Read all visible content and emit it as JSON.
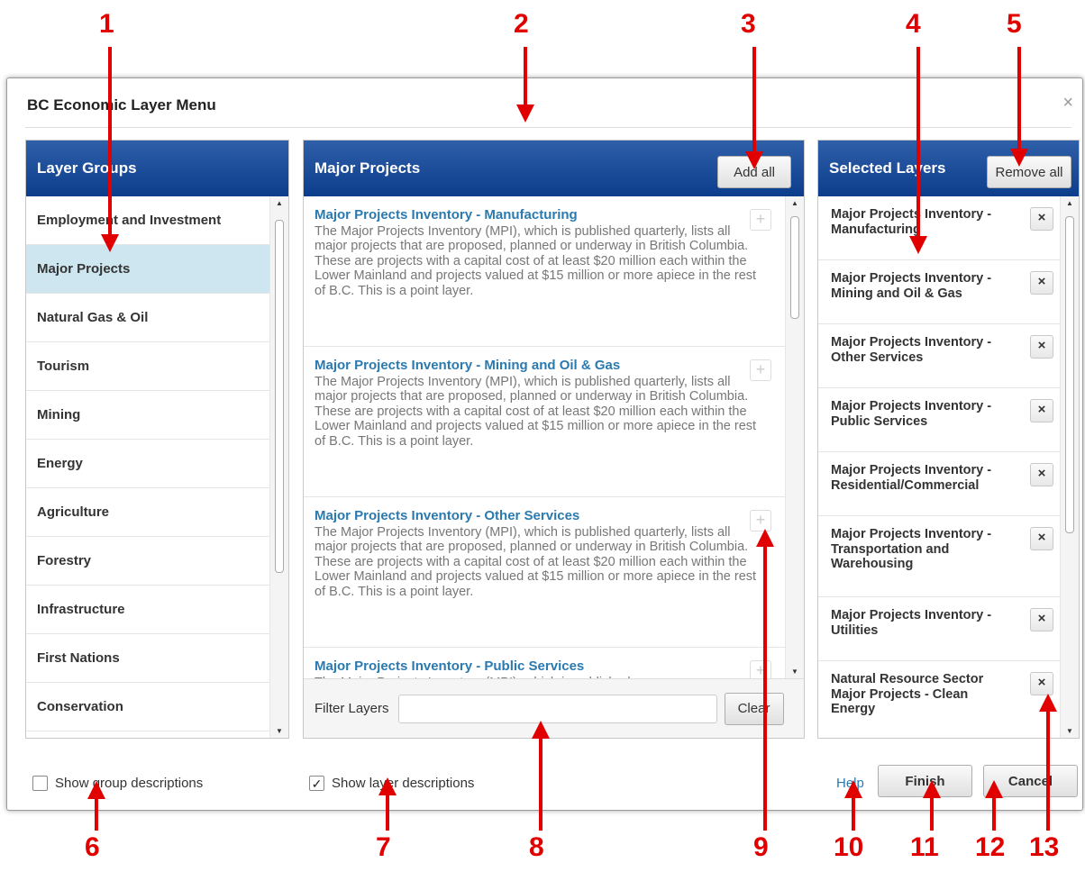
{
  "dialog": {
    "title": "BC Economic Layer Menu",
    "close_glyph": "×"
  },
  "groups": {
    "header": "Layer Groups",
    "items": [
      {
        "label": "Employment and Investment"
      },
      {
        "label": "Major Projects"
      },
      {
        "label": "Natural Gas & Oil"
      },
      {
        "label": "Tourism"
      },
      {
        "label": "Mining"
      },
      {
        "label": "Energy"
      },
      {
        "label": "Agriculture"
      },
      {
        "label": "Forestry"
      },
      {
        "label": "Infrastructure"
      },
      {
        "label": "First Nations"
      },
      {
        "label": "Conservation"
      }
    ],
    "active": "Major Projects"
  },
  "middle": {
    "header": "Major Projects",
    "add_all_label": "Add all",
    "add_glyph": "+",
    "layers": [
      {
        "title": "Major Projects Inventory - Manufacturing",
        "desc": "The Major Projects Inventory (MPI), which is published quarterly, lists all major projects that are proposed, planned or underway in British Columbia. These are projects with a capital cost of at least $20 million each within the Lower Mainland and projects valued at $15 million or more apiece in the rest of B.C. This is a point layer."
      },
      {
        "title": "Major Projects Inventory - Mining and Oil & Gas",
        "desc": "The Major Projects Inventory (MPI), which is published quarterly, lists all major projects that are proposed, planned or underway in British Columbia. These are projects with a capital cost of at least $20 million each within the Lower Mainland and projects valued at $15 million or more apiece in the rest of B.C. This is a point layer."
      },
      {
        "title": "Major Projects Inventory - Other Services",
        "desc": "The Major Projects Inventory (MPI), which is published quarterly, lists all major projects that are proposed, planned or underway in British Columbia. These are projects with a capital cost of at least $20 million each within the Lower Mainland and projects valued at $15 million or more apiece in the rest of B.C. This is a point layer."
      },
      {
        "title": "Major Projects Inventory - Public Services",
        "desc": "The Major Projects Inventory (MPI), which is published"
      }
    ],
    "filter_label": "Filter Layers",
    "filter_value": "",
    "clear_label": "Clear"
  },
  "selected": {
    "header": "Selected Layers",
    "remove_all_label": "Remove all",
    "remove_glyph": "×",
    "items": [
      {
        "label": "Major Projects Inventory - Manufacturing"
      },
      {
        "label": "Major Projects Inventory - Mining and Oil & Gas"
      },
      {
        "label": "Major Projects Inventory - Other Services"
      },
      {
        "label": "Major Projects Inventory - Public Services"
      },
      {
        "label": "Major Projects Inventory - Residential/Commercial"
      },
      {
        "label": "Major Projects Inventory - Transportation and Warehousing"
      },
      {
        "label": "Major Projects Inventory - Utilities"
      },
      {
        "label": "Natural Resource Sector Major Projects - Clean Energy"
      }
    ]
  },
  "footer": {
    "show_group_desc": "Show group descriptions",
    "show_group_desc_checked": false,
    "show_layer_desc": "Show layer descriptions",
    "show_layer_desc_checked": true,
    "check_glyph": "✓",
    "help": "Help",
    "finish": "Finish",
    "cancel": "Cancel"
  },
  "annotations": {
    "color": "#e00000",
    "labels": [
      "1",
      "2",
      "3",
      "4",
      "5",
      "6",
      "7",
      "8",
      "9",
      "10",
      "11",
      "12",
      "13"
    ]
  },
  "scroll_arrows": {
    "up": "▲",
    "down": "▼"
  }
}
